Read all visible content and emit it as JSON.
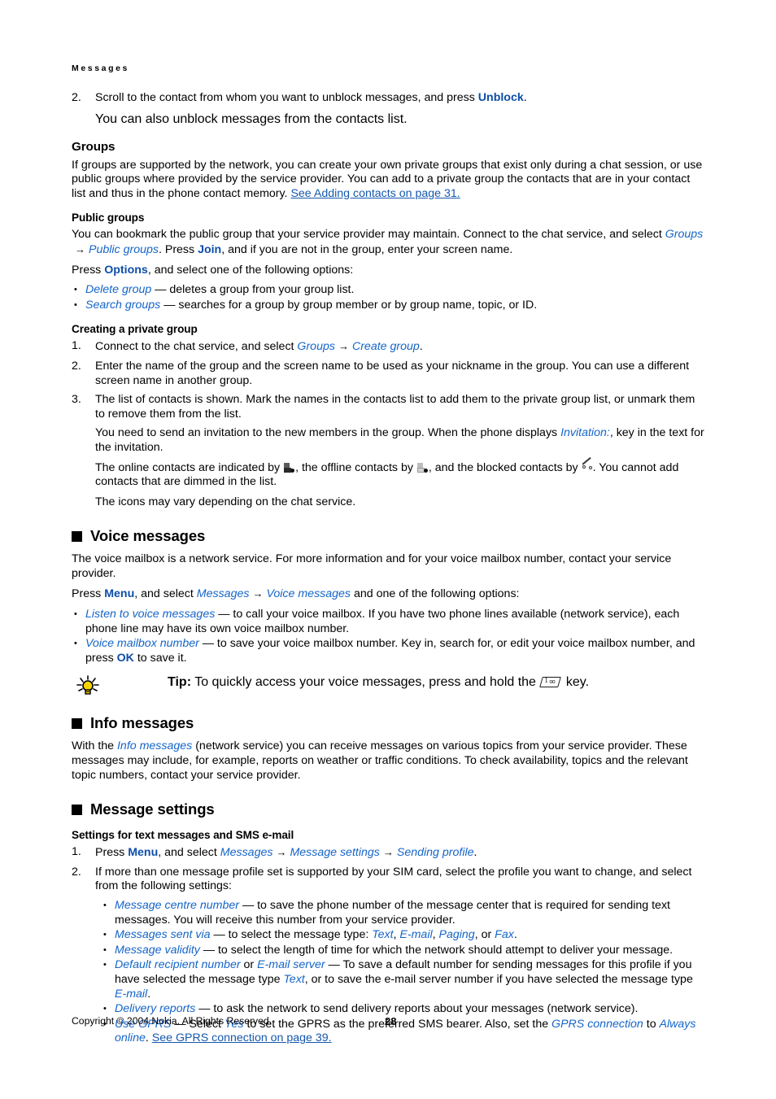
{
  "running_header": "Messages",
  "colors": {
    "link": "#1558b0",
    "italic_term": "#1565c8",
    "bold_key": "#0d4ea8",
    "text": "#000000",
    "bulb": "#f5d400"
  },
  "intro_list": {
    "item2_number": "2.",
    "item2_pre": "Scroll to the contact from whom you want to unblock messages, and press ",
    "item2_key": "Unblock",
    "item2_post": ".",
    "item2_cont": "You can also unblock messages from the contacts list."
  },
  "groups": {
    "heading": "Groups",
    "intro_pre": "If groups are supported by the network, you can create your own private groups that exist only during a chat session, or use public groups where provided by the service provider. You can add to a private group the contacts that are in your contact list and thus in the phone contact memory. ",
    "intro_link": "See Adding contacts on page 31.",
    "public": {
      "heading": "Public groups",
      "p1_a": "You can bookmark the public group that your service provider may maintain. Connect to the chat service, and select ",
      "p1_term1": "Groups",
      "p1_arrow": "→",
      "p1_term2": "Public groups",
      "p1_b": ". Press ",
      "p1_key": "Join",
      "p1_c": ", and if you are not in the group, enter your screen name.",
      "p2_a": "Press ",
      "p2_key": "Options",
      "p2_b": ", and select one of the following options:",
      "options": [
        {
          "term": "Delete group",
          "desc": " — deletes a group from your group list."
        },
        {
          "term": "Search groups",
          "desc": " — searches for a group by group member or by group name, topic, or ID."
        }
      ]
    },
    "private": {
      "heading": "Creating a private group",
      "step1_number": "1.",
      "step1_a": "Connect to the chat service, and select ",
      "step1_term1": "Groups",
      "step1_arrow": "→",
      "step1_term2": "Create group",
      "step1_b": ".",
      "step2_number": "2.",
      "step2": "Enter the name of the group and the screen name to be used as your nickname in the group. You can use a different screen name in another group.",
      "step3_number": "3.",
      "step3": "The list of contacts is shown. Mark the names in the contacts list to add them to the private group list, or unmark them to remove them from the list.",
      "step3_p1_a": "You need to send an invitation to the new members in the group. When the phone displays ",
      "step3_p1_term": "Invitation:",
      "step3_p1_b": ", key in the text for the invitation.",
      "step3_p2_a": "The online contacts are indicated by ",
      "step3_p2_b": ", the offline contacts by ",
      "step3_p2_c": ", and the blocked contacts by ",
      "step3_p2_d": ". You cannot add contacts that are dimmed in the list.",
      "step3_p3": "The icons may vary depending on the chat service."
    }
  },
  "voice_messages": {
    "heading": "Voice messages",
    "p1": "The voice mailbox is a network service. For more information and for your voice mailbox number, contact your service provider.",
    "p2_a": "Press ",
    "p2_key": "Menu",
    "p2_b": ", and select ",
    "p2_term1": "Messages",
    "p2_arrow": "→",
    "p2_term2": "Voice messages",
    "p2_c": " and one of the following options:",
    "options": [
      {
        "term": "Listen to voice messages",
        "desc": " — to call your voice mailbox. If you have two phone lines available (network service), each phone line may have its own voice mailbox number."
      },
      {
        "term": "Voice mailbox number",
        "desc_a": " — to save your voice mailbox number. Key in, search for, or edit your voice mailbox number, and press ",
        "key": "OK",
        "desc_b": " to save it."
      }
    ],
    "tip": {
      "label": "Tip:",
      "text_a": " To quickly access your voice messages, press and hold the ",
      "key_label": "1",
      "key_sub": "oo",
      "text_b": " key."
    }
  },
  "info_messages": {
    "heading": "Info messages",
    "p1_a": "With the ",
    "p1_term": "Info messages",
    "p1_b": " (network service) you can receive messages on various topics from your service provider. These messages may include, for example, reports on weather or traffic conditions. To check availability, topics and the relevant topic numbers, contact your service provider."
  },
  "message_settings": {
    "heading": "Message settings",
    "sub_heading": "Settings for text messages and SMS e-mail",
    "step1_number": "1.",
    "step1_a": "Press ",
    "step1_key": "Menu",
    "step1_b": ", and select ",
    "step1_term1": "Messages",
    "step1_arrow1": "→",
    "step1_term2": "Message settings",
    "step1_arrow2": "→",
    "step1_term3": "Sending profile",
    "step1_c": ".",
    "step2_number": "2.",
    "step2": "If more than one message profile set is supported by your SIM card, select the profile you want to change, and select from the following settings:",
    "settings": [
      {
        "term": "Message centre number",
        "desc": " — to save the phone number of the message center that is required for sending text messages. You will receive this number from your service provider."
      },
      {
        "term": "Messages sent via",
        "desc_a": " — to select the message type: ",
        "t1": "Text",
        "s1": ", ",
        "t2": "E-mail",
        "s2": ", ",
        "t3": "Paging",
        "s3": ", or ",
        "t4": "Fax",
        "s4": "."
      },
      {
        "term": "Message validity",
        "desc": " —  to select the length of time for which the network should attempt to deliver your message."
      },
      {
        "term": "Default recipient number",
        "mid": " or ",
        "term2": "E-mail server",
        "desc_a": " — To save a default number for sending messages for this profile if you have selected the message type ",
        "t1": "Text",
        "desc_b": ", or to save the e-mail server number if you have selected the message type ",
        "t2": "E-mail",
        "desc_c": "."
      },
      {
        "term": "Delivery reports",
        "desc": " — to ask the network to send delivery reports about your messages (network service)."
      },
      {
        "term": "Use GPRS",
        "desc_a": " — Select ",
        "t1": "Yes",
        "desc_b": " to set the GPRS as the preferred SMS bearer. Also, set the ",
        "t2": "GPRS connection",
        "desc_c": " to ",
        "t3": "Always online",
        "desc_d": ". ",
        "link": "See GPRS connection on page 39."
      }
    ]
  },
  "footer": {
    "copyright": "Copyright © 2004 Nokia. All Rights Reserved.",
    "page_number": "28"
  }
}
